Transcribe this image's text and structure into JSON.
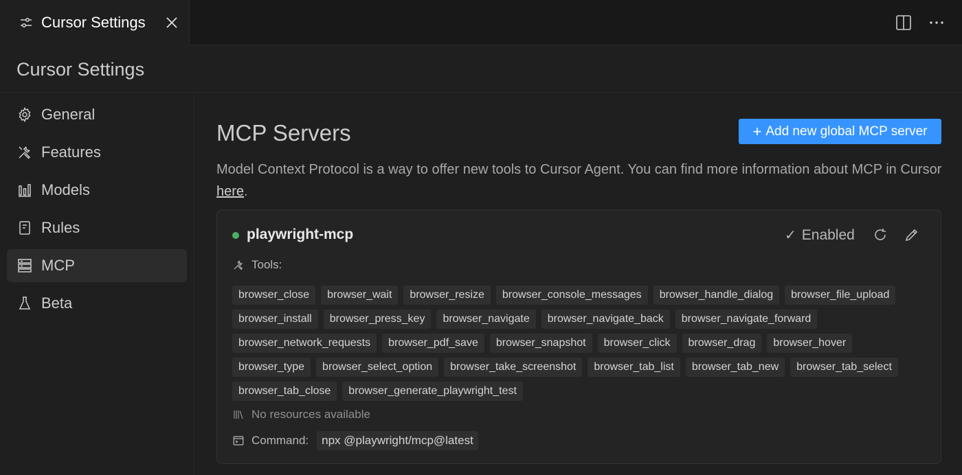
{
  "tab": {
    "label": "Cursor Settings"
  },
  "header": {
    "title": "Cursor Settings"
  },
  "sidebar": {
    "items": [
      {
        "label": "General",
        "icon": "gear-icon"
      },
      {
        "label": "Features",
        "icon": "tools-icon"
      },
      {
        "label": "Models",
        "icon": "bar-chart-icon"
      },
      {
        "label": "Rules",
        "icon": "notebook-icon"
      },
      {
        "label": "MCP",
        "icon": "server-icon",
        "active": true
      },
      {
        "label": "Beta",
        "icon": "flask-icon"
      }
    ]
  },
  "main": {
    "title": "MCP Servers",
    "add_button": "Add new global MCP server",
    "description_prefix": "Model Context Protocol is a way to offer new tools to Cursor Agent. You can find more information about MCP in Cursor ",
    "description_link": "here",
    "description_suffix": "."
  },
  "server": {
    "name": "playwright-mcp",
    "status": "Enabled",
    "status_color": "#4caf68",
    "tools_label": "Tools:",
    "tools": [
      "browser_close",
      "browser_wait",
      "browser_resize",
      "browser_console_messages",
      "browser_handle_dialog",
      "browser_file_upload",
      "browser_install",
      "browser_press_key",
      "browser_navigate",
      "browser_navigate_back",
      "browser_navigate_forward",
      "browser_network_requests",
      "browser_pdf_save",
      "browser_snapshot",
      "browser_click",
      "browser_drag",
      "browser_hover",
      "browser_type",
      "browser_select_option",
      "browser_take_screenshot",
      "browser_tab_list",
      "browser_tab_new",
      "browser_tab_select",
      "browser_tab_close",
      "browser_generate_playwright_test"
    ],
    "resources_text": "No resources available",
    "command_label": "Command:",
    "command_value": "npx @playwright/mcp@latest"
  },
  "colors": {
    "accent": "#3794ff",
    "background": "#181818",
    "panel": "#1f1f1f"
  }
}
